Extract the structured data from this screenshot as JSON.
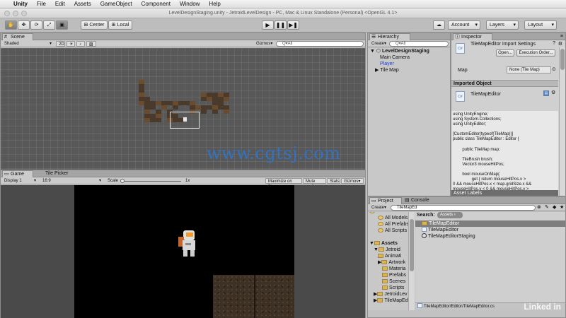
{
  "menubar": {
    "apple": "",
    "items": [
      "Unity",
      "File",
      "Edit",
      "Assets",
      "GameObject",
      "Component",
      "Window",
      "Help"
    ]
  },
  "window": {
    "title": "LevelDesignStaging.unity - JetroidLevelDesign - PC, Mac & Linux Standalone (Personal) <OpenGL 4.1>"
  },
  "toolbar": {
    "pivot_center": "Center",
    "pivot_local": "Local",
    "account": "Account",
    "layers": "Layers",
    "layout": "Layout"
  },
  "scene": {
    "tab": "Scene",
    "shading": "Shaded",
    "mode_2d": "2D",
    "gizmos": "Gizmos",
    "search_placeholder": "Q▾All"
  },
  "game": {
    "tabs": [
      "Game",
      "Tile Picker"
    ],
    "display": "Display 1",
    "aspect": "16:9",
    "scale_label": "Scale",
    "scale_value": "1x",
    "maximize": "Maximize on Play",
    "mute": "Mute audio",
    "stats": "Stats",
    "gizmos": "Gizmos"
  },
  "hierarchy": {
    "tab": "Hierarchy",
    "create": "Create",
    "search_placeholder": "Q▾All",
    "scene_name": "LevelDesignStaging",
    "items": [
      "Main Camera",
      "Player",
      "Tile Map"
    ]
  },
  "inspector": {
    "tab": "Inspector",
    "title": "TileMapEditor Import Settings",
    "open_button": "Open...",
    "exec_order_button": "Execution Order...",
    "map_label": "Map",
    "map_value": "None (Tile Map)",
    "imported_header": "Imported Object",
    "imported_name": "TileMapEditor",
    "code_lines": [
      "using UnityEngine;",
      "using System.Collections;",
      "using UnityEditor;",
      "",
      "[CustomEditor(typeof(TileMap))]",
      "public class TileMapEditor : Editor {",
      "",
      "        public TileMap map;",
      "",
      "        TileBrush brush;",
      "        Vector3 mouseHitPos;",
      "",
      "        bool mouseOnMap{",
      "                get { return mouseHitPos.x >",
      "0 && mouseHitPos.x < map.gridSize.x &&",
      "mouseHitPos.y < 0 && mouseHitPos.y >"
    ],
    "asset_labels": "Asset Labels"
  },
  "project": {
    "tabs": [
      "Project",
      "Console"
    ],
    "create": "Create",
    "search_value": "TileMapEd",
    "search_label": "Search:",
    "assets_chip": "Assets",
    "favorites": [
      "All Models",
      "All Prefabs",
      "All Scripts"
    ],
    "assets_root": "Assets",
    "tree": [
      "Jetroid",
      "Animati",
      "Artwork",
      "Materia",
      "Prefabs",
      "Scenes",
      "Scripts",
      "JetroidLev",
      "TileMapEd"
    ],
    "results": [
      "TileMapEditor",
      "TileMapEditor",
      "TileMapEditorStaging"
    ],
    "path": "TileMapEditor/Editor/TileMapEditor.cs"
  },
  "watermark": "www.cgtsj.com",
  "brand": "Linked in"
}
